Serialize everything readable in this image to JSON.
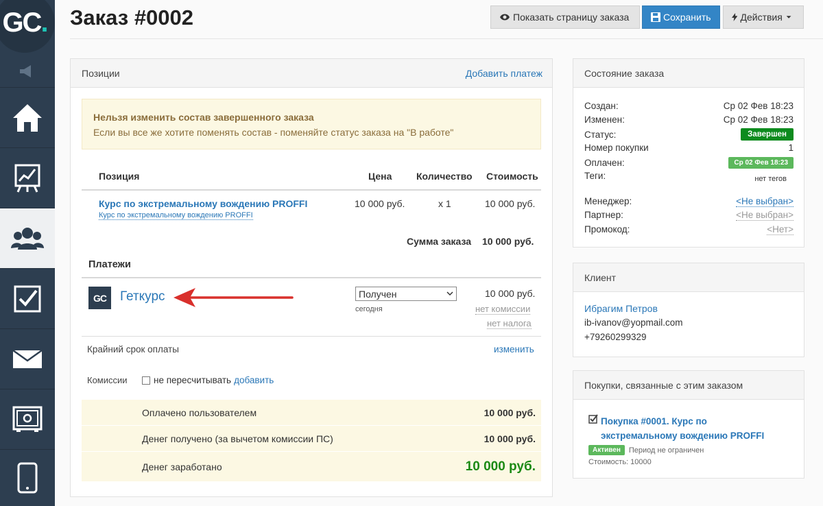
{
  "brand": {
    "logo_text": "GC",
    "logo_dot": "."
  },
  "sidebar": {
    "items": [
      {
        "icon": "megaphone-icon"
      },
      {
        "icon": "home-icon"
      },
      {
        "icon": "chart-icon"
      },
      {
        "icon": "users-icon",
        "active": true
      },
      {
        "icon": "checkbox-icon"
      },
      {
        "icon": "mail-icon"
      },
      {
        "icon": "safe-icon"
      },
      {
        "icon": "mobile-icon"
      }
    ]
  },
  "header": {
    "title": "Заказ #0002",
    "btn_show": "Показать страницу заказа",
    "btn_save": "Сохранить",
    "btn_actions": "Действия"
  },
  "positions": {
    "title": "Позиции",
    "add_payment": "Добавить платеж",
    "warning_title": "Нельзя изменить состав завершенного заказа",
    "warning_text": "Если вы все же хотите поменять состав - поменяйте статус заказа на \"В работе\"",
    "col_position": "Позиция",
    "col_price": "Цена",
    "col_qty": "Количество",
    "col_cost": "Стоимость",
    "item_name": "Курс по экстремальному вождению PROFFI",
    "item_sub": "Курс по экстремальному вождению PROFFI",
    "item_price": "10 000 руб.",
    "item_qty": "x 1",
    "item_cost": "10 000 руб.",
    "sum_label": "Сумма заказа",
    "sum_value": "10 000 руб."
  },
  "payments": {
    "title": "Платежи",
    "provider_logo": "GC",
    "provider_name": "Геткурс",
    "status_value": "Получен",
    "status_date": "сегодня",
    "amount": "10 000 руб.",
    "no_commission": "нет комиссии",
    "no_tax": "нет налога",
    "deadline_label": "Крайний срок оплаты",
    "deadline_change": "изменить",
    "commission_label": "Комиссии",
    "no_recalc": "не пересчитывать",
    "add": "добавить",
    "paid_label": "Оплачено пользователем",
    "paid_value": "10 000 руб.",
    "received_label": "Денег получено (за вычетом комиссии ПС)",
    "received_value": "10 000 руб.",
    "earned_label": "Денег заработано",
    "earned_value": "10 000 руб."
  },
  "order_state": {
    "title": "Состояние заказа",
    "created_label": "Создан:",
    "created_value": "Ср 02 Фев 18:23",
    "changed_label": "Изменен:",
    "changed_value": "Ср 02 Фев 18:23",
    "status_label": "Статус:",
    "status_value": "Завершен",
    "purchase_label": "Номер покупки",
    "purchase_value": "1",
    "paid_label": "Оплачен:",
    "paid_value": "Ср 02 Фев 18:23",
    "tags_label": "Теги:",
    "tags_value": "нет тегов",
    "manager_label": "Менеджер:",
    "manager_value": "<Не выбран>",
    "partner_label": "Партнер:",
    "partner_value": "<Не выбран>",
    "promo_label": "Промокод:",
    "promo_value": "<Нет>"
  },
  "client": {
    "title": "Клиент",
    "name": "Ибрагим Петров",
    "email": "ib-ivanov@yopmail.com",
    "phone": "+79260299329"
  },
  "purchases": {
    "title": "Покупки, связанные с этим заказом",
    "link_line1": "Покупка #0001. Курс по",
    "link_line2": "экстремальному вождению PROFFI",
    "badge": "Активен",
    "period": "Период не ограничен",
    "cost": "Стоимость: 10000"
  },
  "colors": {
    "sidebar": "#2d3e50",
    "primary": "#3385c6",
    "success": "#0d8b1e",
    "warning_bg": "#fcf8e3",
    "arrow": "#d9302c"
  }
}
